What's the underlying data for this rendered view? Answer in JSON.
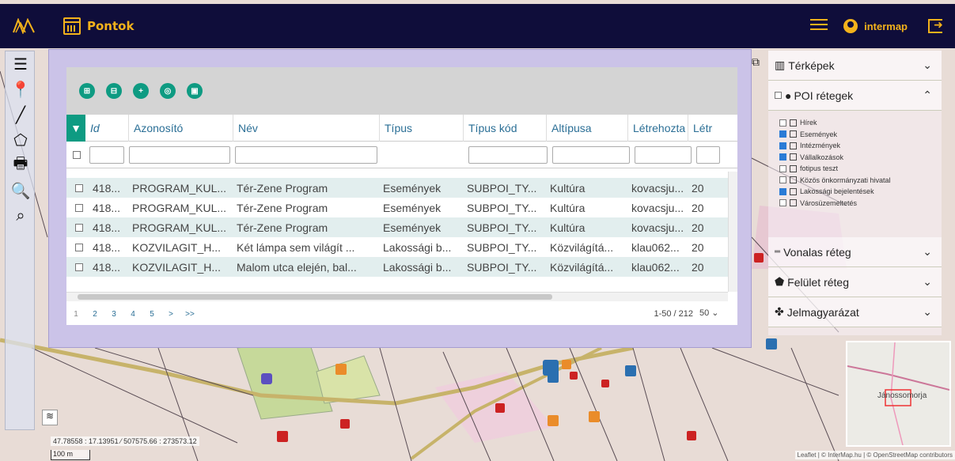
{
  "app": {
    "title": "Pontok",
    "user": "intermap"
  },
  "lefttools": [
    "menu-icon",
    "pin-icon",
    "line-icon",
    "polygon-icon",
    "print-icon",
    "zoom-icon",
    "zoom-area-icon"
  ],
  "map": {
    "coords": "47.78558 : 17.13951",
    "coords2": "507575.66 : 273573.12",
    "scale": "100 m",
    "minimap_label": "Jánossomorja",
    "attribution": "Leaflet | © InterMap.hu | © OpenStreetMap contributors"
  },
  "grid": {
    "columns": [
      "Id",
      "Azonosító",
      "Név",
      "Típus",
      "Típus kód",
      "Altípusa",
      "Létrehozta",
      "Létr"
    ],
    "rows": [
      [
        "418...",
        "PROGRAM_KUL...",
        "Tér-Zene Program",
        "Események",
        "SUBPOI_TY...",
        "Kultúra",
        "kovacsju...",
        "20"
      ],
      [
        "418...",
        "PROGRAM_KUL...",
        "Tér-Zene Program",
        "Események",
        "SUBPOI_TY...",
        "Kultúra",
        "kovacsju...",
        "20"
      ],
      [
        "418...",
        "PROGRAM_KUL...",
        "Tér-Zene Program",
        "Események",
        "SUBPOI_TY...",
        "Kultúra",
        "kovacsju...",
        "20"
      ],
      [
        "418...",
        "KOZVILAGIT_H...",
        "Két lámpa sem világít ...",
        "Lakossági b...",
        "SUBPOI_TY...",
        "Közvilágítá...",
        "klau062...",
        "20"
      ],
      [
        "418...",
        "KOZVILAGIT_H...",
        "Malom utca elején, bal...",
        "Lakossági b...",
        "SUBPOI_TY...",
        "Közvilágítá...",
        "klau062...",
        "20"
      ]
    ],
    "pager": {
      "pages": [
        "1",
        "2",
        "3",
        "4",
        "5",
        ">",
        ">>"
      ],
      "info": "1-50 / 212",
      "page_size": "50"
    }
  },
  "right": {
    "terkepek": "Térképek",
    "poi": "POI rétegek",
    "poi_items": [
      {
        "label": "Hírek",
        "checked": false
      },
      {
        "label": "Események",
        "checked": true
      },
      {
        "label": "Intézmények",
        "checked": true
      },
      {
        "label": "Vállalkozások",
        "checked": true
      },
      {
        "label": "fotipus teszt",
        "checked": false
      },
      {
        "label": "Közös önkormányzati hivatal",
        "checked": false
      },
      {
        "label": "Lakossági bejelentések",
        "checked": true
      },
      {
        "label": "Városüzemeltetés",
        "checked": false
      }
    ],
    "vonalas": "Vonalas réteg",
    "felulet": "Felület réteg",
    "jelmagyarazat": "Jelmagyarázat"
  },
  "colors": {
    "topbar": "#0f0d3a",
    "accent": "#f3b21b",
    "teal": "#0e9b82"
  }
}
